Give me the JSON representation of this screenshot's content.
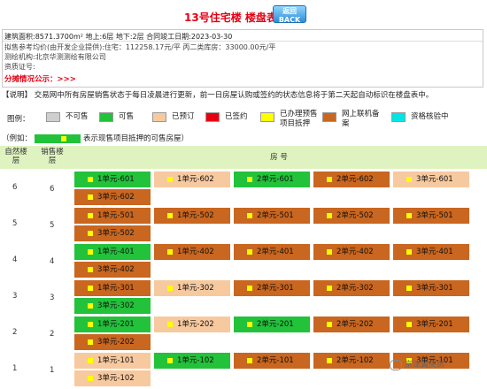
{
  "header": {
    "title": "13号住宅楼 楼盘表",
    "back_top": "返回",
    "back_bottom": "BACK"
  },
  "info": {
    "line1": "建筑面积:8571.3700m² 地上:6层 地下:2层 合同竣工日期:2023-03-30",
    "line2": "拟售参考均价(由开发企业提供):住宅：112258.17元/平 丙二类库房：33000.00元/平",
    "line3": "测绘机构:北京华测测绘有限公司",
    "line4": "资质证号:",
    "line5": "分摊情况公示：>>>"
  },
  "notice": "【说明】 交易网中所有房屋销售状态于每日凌晨进行更新，前一日房屋认购或签约的状态信息将于第二天起自动标识在楼盘表中。",
  "legend": {
    "title": "图例：",
    "items": [
      {
        "label": "不可售",
        "color": "#cfcfcf"
      },
      {
        "label": "可售",
        "color": "#22c23a"
      },
      {
        "label": "已预订",
        "color": "#f7c99f"
      },
      {
        "label": "已签约",
        "color": "#e60012"
      },
      {
        "label": "已办理预售项目抵押",
        "color": "#ffff00"
      },
      {
        "label": "网上联机备案",
        "color": "#c9661f"
      },
      {
        "label": "资格核验中",
        "color": "#00e5e5"
      }
    ]
  },
  "example": {
    "prefix": "（例如：",
    "suffix": "表示现售项目抵押的可售房屋）"
  },
  "table": {
    "col_natural": "自然楼层",
    "col_sale": "销售楼层",
    "col_room": "房 号",
    "floors": [
      {
        "natural": "6",
        "sale": "6",
        "rooms": [
          {
            "label": "1单元-601",
            "status": "可售"
          },
          {
            "label": "1单元-602",
            "status": "已预订"
          },
          {
            "label": "2单元-601",
            "status": "可售"
          },
          {
            "label": "2单元-602",
            "status": "网上联机备案"
          },
          {
            "label": "3单元-601",
            "status": "已预订"
          },
          {
            "label": "3单元-602",
            "status": "网上联机备案"
          }
        ]
      },
      {
        "natural": "5",
        "sale": "5",
        "rooms": [
          {
            "label": "1单元-501",
            "status": "网上联机备案"
          },
          {
            "label": "1单元-502",
            "status": "网上联机备案"
          },
          {
            "label": "2单元-501",
            "status": "网上联机备案"
          },
          {
            "label": "2单元-502",
            "status": "网上联机备案"
          },
          {
            "label": "3单元-501",
            "status": "网上联机备案"
          },
          {
            "label": "3单元-502",
            "status": "网上联机备案"
          }
        ]
      },
      {
        "natural": "4",
        "sale": "4",
        "rooms": [
          {
            "label": "1单元-401",
            "status": "可售"
          },
          {
            "label": "1单元-402",
            "status": "网上联机备案"
          },
          {
            "label": "2单元-401",
            "status": "网上联机备案"
          },
          {
            "label": "2单元-402",
            "status": "网上联机备案"
          },
          {
            "label": "3单元-401",
            "status": "网上联机备案"
          },
          {
            "label": "3单元-402",
            "status": "网上联机备案"
          }
        ]
      },
      {
        "natural": "3",
        "sale": "3",
        "rooms": [
          {
            "label": "1单元-301",
            "status": "网上联机备案"
          },
          {
            "label": "1单元-302",
            "status": "已预订"
          },
          {
            "label": "2单元-301",
            "status": "网上联机备案"
          },
          {
            "label": "2单元-302",
            "status": "网上联机备案"
          },
          {
            "label": "3单元-301",
            "status": "网上联机备案"
          },
          {
            "label": "3单元-302",
            "status": "可售"
          }
        ]
      },
      {
        "natural": "2",
        "sale": "2",
        "rooms": [
          {
            "label": "1单元-201",
            "status": "可售"
          },
          {
            "label": "1单元-202",
            "status": "已预订"
          },
          {
            "label": "2单元-201",
            "status": "可售"
          },
          {
            "label": "2单元-202",
            "status": "网上联机备案"
          },
          {
            "label": "3单元-201",
            "status": "网上联机备案"
          },
          {
            "label": "3单元-202",
            "status": "网上联机备案"
          }
        ]
      },
      {
        "natural": "1",
        "sale": "1",
        "rooms": [
          {
            "label": "1单元-101",
            "status": "已预订"
          },
          {
            "label": "1单元-102",
            "status": "可售"
          },
          {
            "label": "2单元-101",
            "status": "网上联机备案"
          },
          {
            "label": "2单元-102",
            "status": "网上联机备案"
          },
          {
            "label": "3单元-101",
            "status": "网上联机备案"
          },
          {
            "label": "3单元-102",
            "status": "已预订"
          }
        ]
      }
    ]
  },
  "status_colors": {
    "可售": "#22c23a",
    "已预订": "#f7c99f",
    "网上联机备案": "#c9661f"
  },
  "watermark": "京津冀买房"
}
